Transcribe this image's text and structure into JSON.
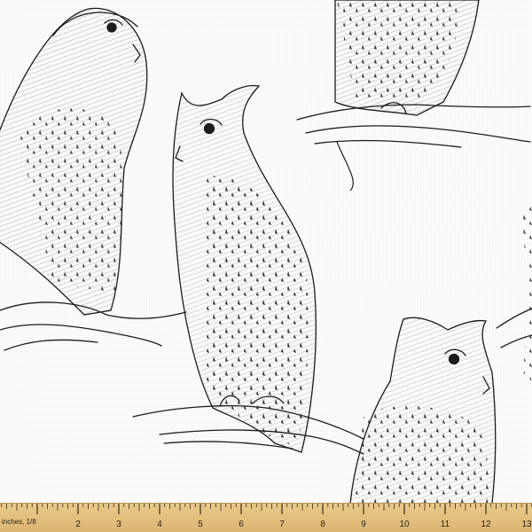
{
  "image": {
    "subject": "",
    "colors": {
      "ink": "#1c1c1c",
      "fabric": "#fbfbf9",
      "ruler": "#e2bf7c"
    }
  },
  "ruler": {
    "unit_label": "inches, 1/8",
    "numbers": [
      "2",
      "3",
      "4",
      "5",
      "6",
      "7",
      "8",
      "9",
      "10",
      "11",
      "12",
      "13"
    ]
  }
}
